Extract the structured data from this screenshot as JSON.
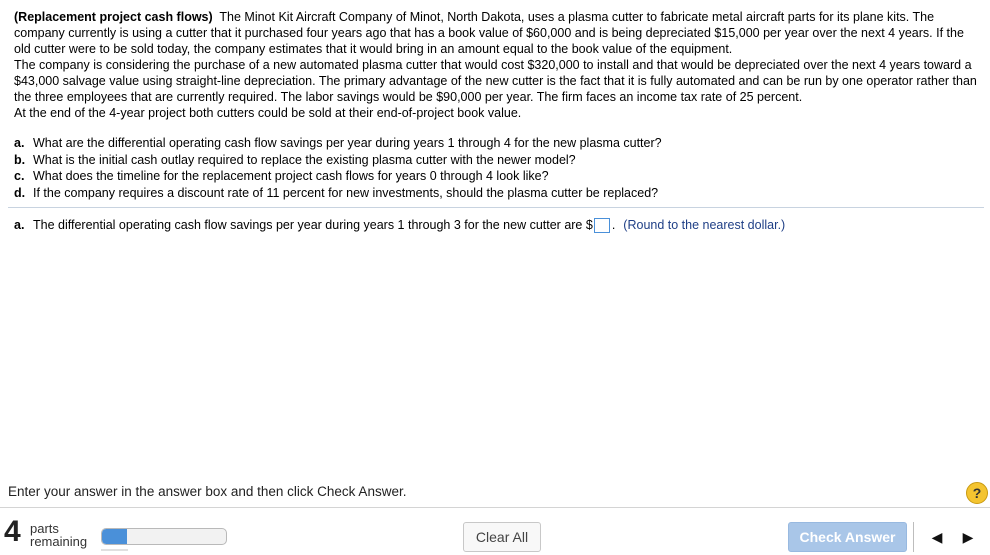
{
  "problem": {
    "title": "(Replacement project cash flows)",
    "paragraph1": "The Minot Kit Aircraft Company of Minot, North Dakota, uses a plasma cutter to fabricate metal aircraft parts for its plane kits.  The company currently is using a cutter that it purchased four years ago that has a book value of $60,000 and is being depreciated $15,000 per year over the next 4 years.  If the old cutter were to be sold today, the company estimates that it would bring in an amount equal to the book value of the equipment.",
    "paragraph2": "The company is considering the purchase of a new automated plasma cutter that would cost $320,000 to install and that would be depreciated over the next 4 years toward a $43,000 salvage value using straight-line depreciation.  The primary advantage of the new cutter is the fact that it is fully automated and can be run by one operator rather than the three employees that are currently required.  The labor savings would be $90,000 per year.  The firm faces an income tax rate of 25 percent.",
    "paragraph3": "At the end of the 4-year project both cutters could be sold at their end-of-project book value."
  },
  "questions": [
    {
      "label": "a.",
      "text": "What are the differential operating cash flow savings per year during years 1 through 4 for the new plasma cutter?"
    },
    {
      "label": "b.",
      "text": "What is the initial cash outlay required to replace the existing plasma cutter with the newer model?"
    },
    {
      "label": "c.",
      "text": "What does the timeline for the replacement project cash flows for years 0 through 4 look like?"
    },
    {
      "label": "d.",
      "text": "If the company requires a discount rate of 11 percent for new investments, should the plasma cutter be replaced?"
    }
  ],
  "answer": {
    "label": "a.",
    "prompt": "The differential operating cash flow savings per year during years 1 through 3 for the new cutter are $",
    "value": "",
    "suffix": ".",
    "hint": "(Round to the nearest dollar.)"
  },
  "footer": {
    "instruction": "Enter your answer in the answer box and then click Check Answer.",
    "help_icon": "?",
    "parts_count": "4",
    "parts_line1": "parts",
    "parts_line2": "remaining",
    "progress_fraction": 0.2,
    "clear_label": "Clear All",
    "check_label": "Check Answer",
    "prev_icon": "◀",
    "next_icon": "▶"
  }
}
